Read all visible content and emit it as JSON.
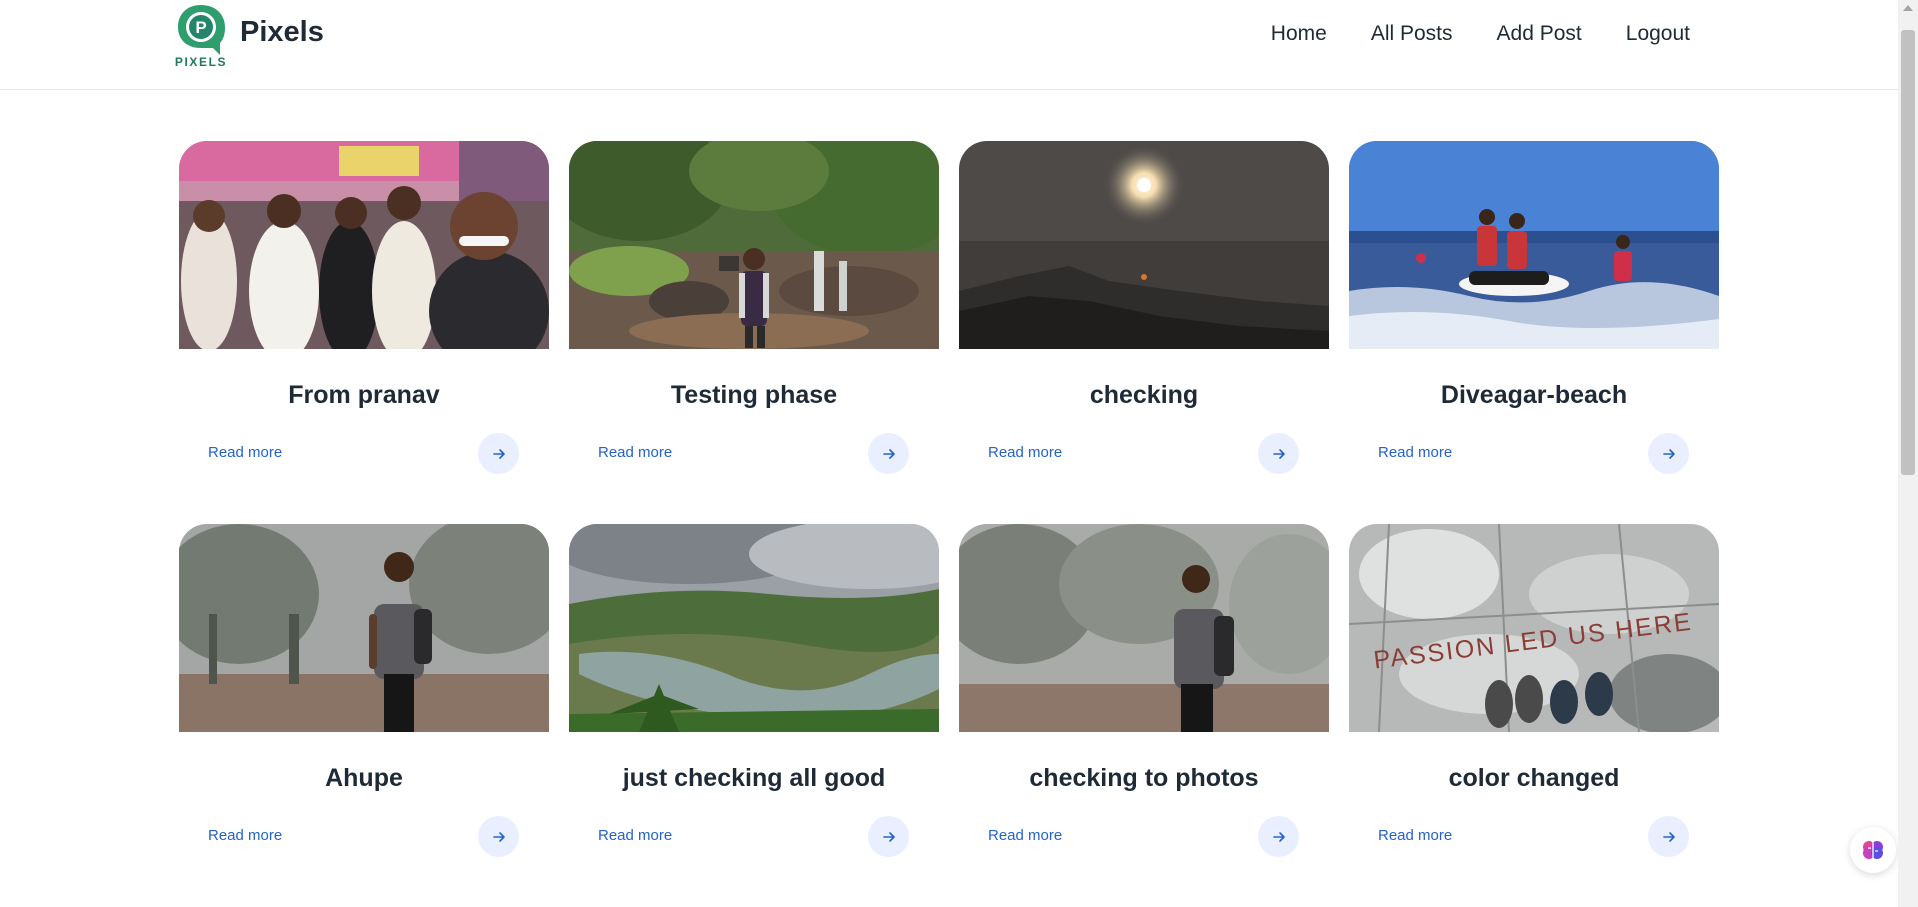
{
  "header": {
    "logo_word": "PIXELS",
    "brand": "Pixels",
    "nav": [
      "Home",
      "All Posts",
      "Add Post",
      "Logout"
    ]
  },
  "posts": [
    {
      "title": "From pranav",
      "read_more": "Read more"
    },
    {
      "title": "Testing phase",
      "read_more": "Read more"
    },
    {
      "title": "checking",
      "read_more": "Read more"
    },
    {
      "title": "Diveagar-beach",
      "read_more": "Read more"
    },
    {
      "title": "Ahupe",
      "read_more": "Read more"
    },
    {
      "title": "just checking all good",
      "read_more": "Read more"
    },
    {
      "title": "checking to photos",
      "read_more": "Read more"
    },
    {
      "title": "color changed",
      "read_more": "Read more"
    }
  ],
  "photo_text": "PASSION LED US HERE",
  "colors": {
    "link": "#2563c9",
    "arrow_bg": "#e9efff",
    "logo_green": "#1f7a5c"
  }
}
